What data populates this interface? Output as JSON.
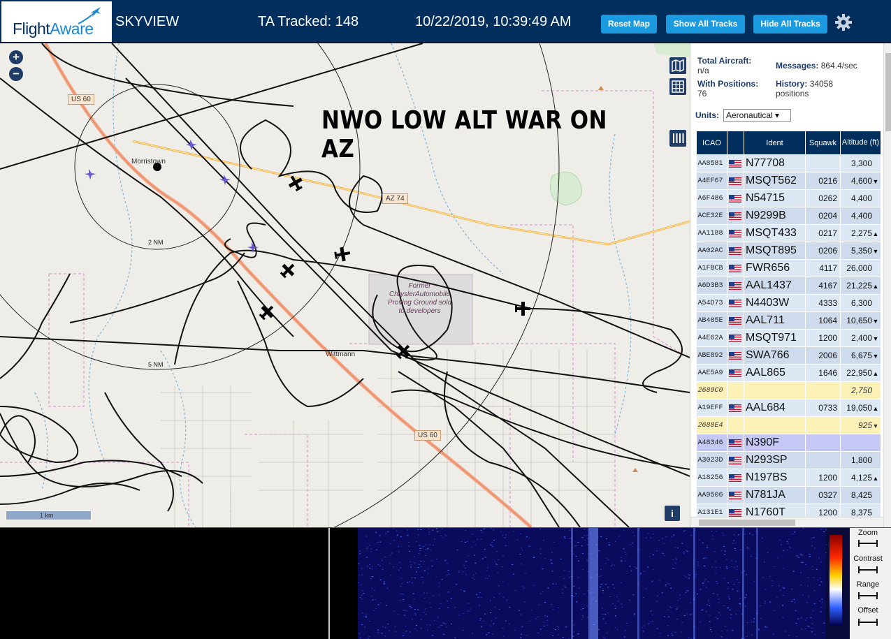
{
  "header": {
    "logo_flight": "Flight",
    "logo_aware": "Aware",
    "app_name": "SKYVIEW",
    "tracked": "TA Tracked: 148",
    "datetime": "10/22/2019, 10:39:49 AM",
    "buttons": {
      "reset_map": "Reset Map",
      "show_all_tracks": "Show All Tracks",
      "hide_all_tracks": "Hide All Tracks"
    }
  },
  "map": {
    "zoom_in": "+",
    "zoom_out": "−",
    "annotation": "NWO LOW ALT WAR ON AZ",
    "places": {
      "morristown": "Morristown",
      "wittmann": "Wittmann"
    },
    "roads": {
      "us60_north": "US 60",
      "az74": "AZ 74",
      "us60_south": "US 60"
    },
    "rings": {
      "inner": "2 NM",
      "outer": "5 NM"
    },
    "proving_ground": "Former ChryslerAutomobile Proving Ground sold to developers",
    "scale": "1 km",
    "info": "i"
  },
  "panel": {
    "stats": {
      "total_aircraft_label": "Total Aircraft:",
      "total_aircraft_value": "n/a",
      "with_positions_label": "With Positions:",
      "with_positions_value": "76",
      "messages_label": "Messages:",
      "messages_value": "864.4/sec",
      "history_label": "History:",
      "history_value": "34058",
      "history_unit": "positions"
    },
    "units_label": "Units:",
    "units_value": "Aeronautical ▾",
    "columns": {
      "icao": "ICAO",
      "ident": "Ident",
      "squawk": "Squawk",
      "altitude": "Altitude (ft)"
    },
    "rows": [
      {
        "icao": "AA8581",
        "ident": "N77708",
        "squawk": "",
        "altitude": "3,300",
        "trend": "",
        "kind": "normal"
      },
      {
        "icao": "A4EF67",
        "ident": "MSQT562",
        "squawk": "0216",
        "altitude": "4,600",
        "trend": "▼",
        "kind": "normal"
      },
      {
        "icao": "A6F486",
        "ident": "N54715",
        "squawk": "0262",
        "altitude": "4,400",
        "trend": "",
        "kind": "normal"
      },
      {
        "icao": "ACE32E",
        "ident": "N9299B",
        "squawk": "0204",
        "altitude": "4,400",
        "trend": "",
        "kind": "normal"
      },
      {
        "icao": "AA1188",
        "ident": "MSQT433",
        "squawk": "0217",
        "altitude": "2,275",
        "trend": "▲",
        "kind": "normal"
      },
      {
        "icao": "AA02AC",
        "ident": "MSQT895",
        "squawk": "0206",
        "altitude": "5,350",
        "trend": "▼",
        "kind": "normal"
      },
      {
        "icao": "A1FBCB",
        "ident": "FWR656",
        "squawk": "4117",
        "altitude": "26,000",
        "trend": "",
        "kind": "normal"
      },
      {
        "icao": "A6D3B3",
        "ident": "AAL1437",
        "squawk": "4167",
        "altitude": "21,225",
        "trend": "▲",
        "kind": "normal"
      },
      {
        "icao": "A54D73",
        "ident": "N4403W",
        "squawk": "4333",
        "altitude": "6,300",
        "trend": "",
        "kind": "normal"
      },
      {
        "icao": "AB485E",
        "ident": "AAL711",
        "squawk": "1064",
        "altitude": "10,650",
        "trend": "▼",
        "kind": "normal"
      },
      {
        "icao": "A4E62A",
        "ident": "MSQT971",
        "squawk": "1200",
        "altitude": "2,400",
        "trend": "▼",
        "kind": "normal"
      },
      {
        "icao": "ABE892",
        "ident": "SWA766",
        "squawk": "2006",
        "altitude": "6,675",
        "trend": "▼",
        "kind": "normal"
      },
      {
        "icao": "AAE5A9",
        "ident": "AAL865",
        "squawk": "1646",
        "altitude": "22,950",
        "trend": "▲",
        "kind": "normal"
      },
      {
        "icao": "2689C0",
        "ident": "",
        "squawk": "",
        "altitude": "2,750",
        "trend": "",
        "kind": "mlat"
      },
      {
        "icao": "A19EFF",
        "ident": "AAL684",
        "squawk": "0733",
        "altitude": "19,050",
        "trend": "▲",
        "kind": "normal"
      },
      {
        "icao": "2688E4",
        "ident": "",
        "squawk": "",
        "altitude": "925",
        "trend": "▼",
        "kind": "mlat"
      },
      {
        "icao": "A48346",
        "ident": "N390F",
        "squawk": "",
        "altitude": "",
        "trend": "",
        "kind": "sel"
      },
      {
        "icao": "A3023D",
        "ident": "N293SP",
        "squawk": "",
        "altitude": "1,800",
        "trend": "",
        "kind": "normal"
      },
      {
        "icao": "A18256",
        "ident": "N197BS",
        "squawk": "1200",
        "altitude": "4,125",
        "trend": "▲",
        "kind": "normal"
      },
      {
        "icao": "AA9506",
        "ident": "N781JA",
        "squawk": "0327",
        "altitude": "8,425",
        "trend": "",
        "kind": "normal"
      },
      {
        "icao": "A131E1",
        "ident": "N1760T",
        "squawk": "1200",
        "altitude": "8,375",
        "trend": "",
        "kind": "normal"
      }
    ]
  },
  "spectrum": {
    "controls": {
      "zoom": "Zoom",
      "contrast": "Contrast",
      "range": "Range",
      "offset": "Offset"
    }
  }
}
